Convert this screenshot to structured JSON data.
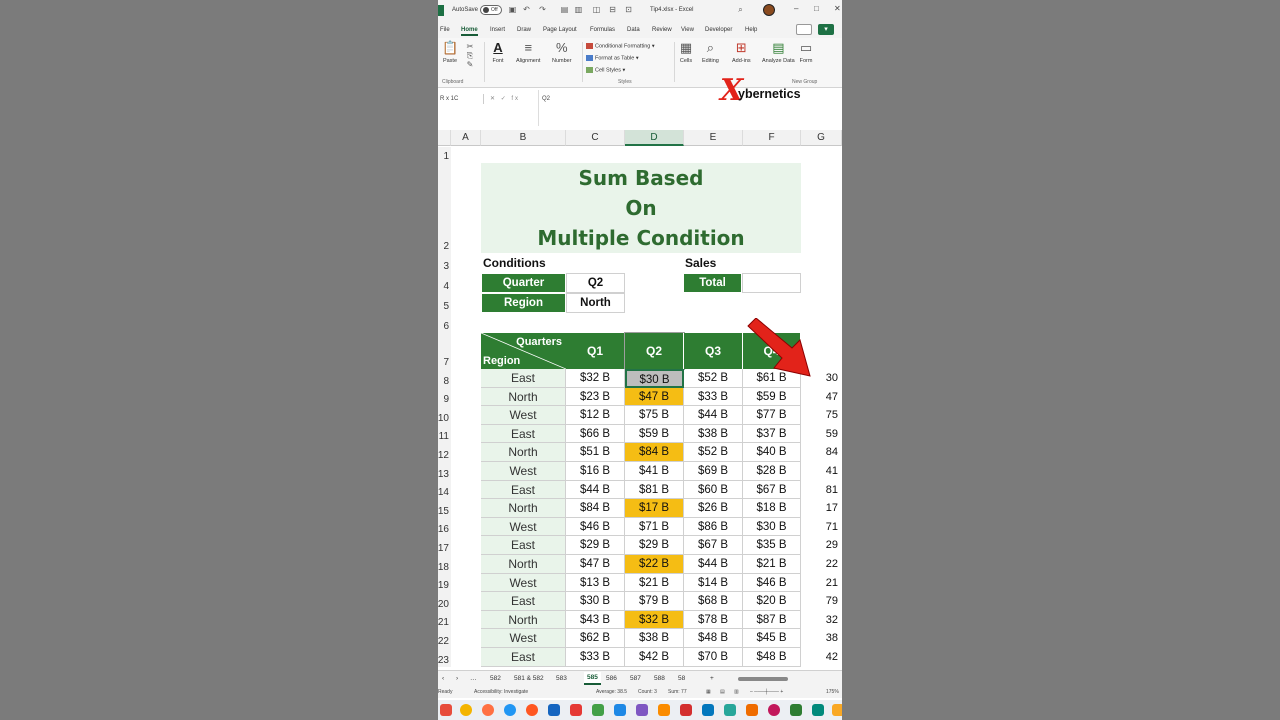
{
  "window": {
    "autosave_label": "AutoSave",
    "autosave_state": "Off",
    "filename": "Tip4.xlsx  -  Excel"
  },
  "ribbon_tabs": [
    "File",
    "Home",
    "Insert",
    "Draw",
    "Page Layout",
    "Formulas",
    "Data",
    "Review",
    "View",
    "Developer",
    "Help"
  ],
  "ribbon": {
    "paste": "Paste",
    "clipboard": "Clipboard",
    "font": "Font",
    "alignment": "Alignment",
    "number": "Number",
    "conditional_formatting": "Conditional Formatting",
    "format_as_table": "Format as Table",
    "cell_styles": "Cell Styles",
    "styles": "Styles",
    "cells": "Cells",
    "editing": "Editing",
    "addins": "Add-ins",
    "analyze_data": "Analyze Data",
    "form": "Form",
    "new_group": "New Group"
  },
  "formula_bar": {
    "name_box": "R x 1C",
    "fx": "fx",
    "value": "Q2"
  },
  "brand": {
    "x": "X",
    "text": "ybernetics"
  },
  "columns": [
    "A",
    "B",
    "C",
    "D",
    "E",
    "F",
    "G"
  ],
  "sheet": {
    "title_lines": [
      "Sum Based",
      "On",
      "Multiple Condition"
    ],
    "conditions_label": "Conditions",
    "quarter_label": "Quarter",
    "quarter_value": "Q2",
    "region_label": "Region",
    "region_value": "North",
    "sales_label": "Sales",
    "total_label": "Total",
    "total_value": "",
    "header_quarters": "Quarters",
    "header_region": "Region",
    "quarter_headers": [
      "Q1",
      "Q2",
      "Q3",
      "Q4"
    ]
  },
  "table_rows": [
    {
      "region": "East",
      "q1": "$32 B",
      "q2": "$30 B",
      "q3": "$52 B",
      "q4": "$61 B",
      "g": "30"
    },
    {
      "region": "North",
      "q1": "$23 B",
      "q2": "$47 B",
      "q3": "$33 B",
      "q4": "$59 B",
      "g": "47"
    },
    {
      "region": "West",
      "q1": "$12 B",
      "q2": "$75 B",
      "q3": "$44 B",
      "q4": "$77 B",
      "g": "75"
    },
    {
      "region": "East",
      "q1": "$66 B",
      "q2": "$59 B",
      "q3": "$38 B",
      "q4": "$37 B",
      "g": "59"
    },
    {
      "region": "North",
      "q1": "$51 B",
      "q2": "$84 B",
      "q3": "$52 B",
      "q4": "$40 B",
      "g": "84"
    },
    {
      "region": "West",
      "q1": "$16 B",
      "q2": "$41 B",
      "q3": "$69 B",
      "q4": "$28 B",
      "g": "41"
    },
    {
      "region": "East",
      "q1": "$44 B",
      "q2": "$81 B",
      "q3": "$60 B",
      "q4": "$67 B",
      "g": "81"
    },
    {
      "region": "North",
      "q1": "$84 B",
      "q2": "$17 B",
      "q3": "$26 B",
      "q4": "$18 B",
      "g": "17"
    },
    {
      "region": "West",
      "q1": "$46 B",
      "q2": "$71 B",
      "q3": "$86 B",
      "q4": "$30 B",
      "g": "71"
    },
    {
      "region": "East",
      "q1": "$29 B",
      "q2": "$29 B",
      "q3": "$67 B",
      "q4": "$35 B",
      "g": "29"
    },
    {
      "region": "North",
      "q1": "$47 B",
      "q2": "$22 B",
      "q3": "$44 B",
      "q4": "$21 B",
      "g": "22"
    },
    {
      "region": "West",
      "q1": "$13 B",
      "q2": "$21 B",
      "q3": "$14 B",
      "q4": "$46 B",
      "g": "21"
    },
    {
      "region": "East",
      "q1": "$30 B",
      "q2": "$79 B",
      "q3": "$68 B",
      "q4": "$20 B",
      "g": "79"
    },
    {
      "region": "North",
      "q1": "$43 B",
      "q2": "$32 B",
      "q3": "$78 B",
      "q4": "$87 B",
      "g": "32"
    },
    {
      "region": "West",
      "q1": "$62 B",
      "q2": "$38 B",
      "q3": "$48 B",
      "q4": "$45 B",
      "g": "38"
    },
    {
      "region": "East",
      "q1": "$33 B",
      "q2": "$42 B",
      "q3": "$70 B",
      "q4": "$48 B",
      "g": "42"
    }
  ],
  "highlight_rows": [
    4,
    7,
    10,
    13
  ],
  "row_numbers": [
    "1",
    "2",
    "3",
    "4",
    "5",
    "6",
    "7",
    "8",
    "9",
    "10",
    "11",
    "12",
    "13",
    "14",
    "15",
    "16",
    "17",
    "18",
    "19",
    "20",
    "21",
    "22",
    "23"
  ],
  "sheet_tabs": [
    "582",
    "581 & 582",
    "583",
    "585",
    "586",
    "587",
    "588",
    "58"
  ],
  "active_sheet_tab": "585",
  "status": {
    "ready": "Ready",
    "accessibility": "Accessibility: Investigate",
    "average": "Average: 38.5",
    "count": "Count: 3",
    "sum": "Sum: 77",
    "zoom": "175%"
  },
  "colors": {
    "green": "#2e7d32",
    "light_green": "#e9f4ea",
    "highlight": "#f5bd14",
    "arrow": "#e2231a"
  }
}
